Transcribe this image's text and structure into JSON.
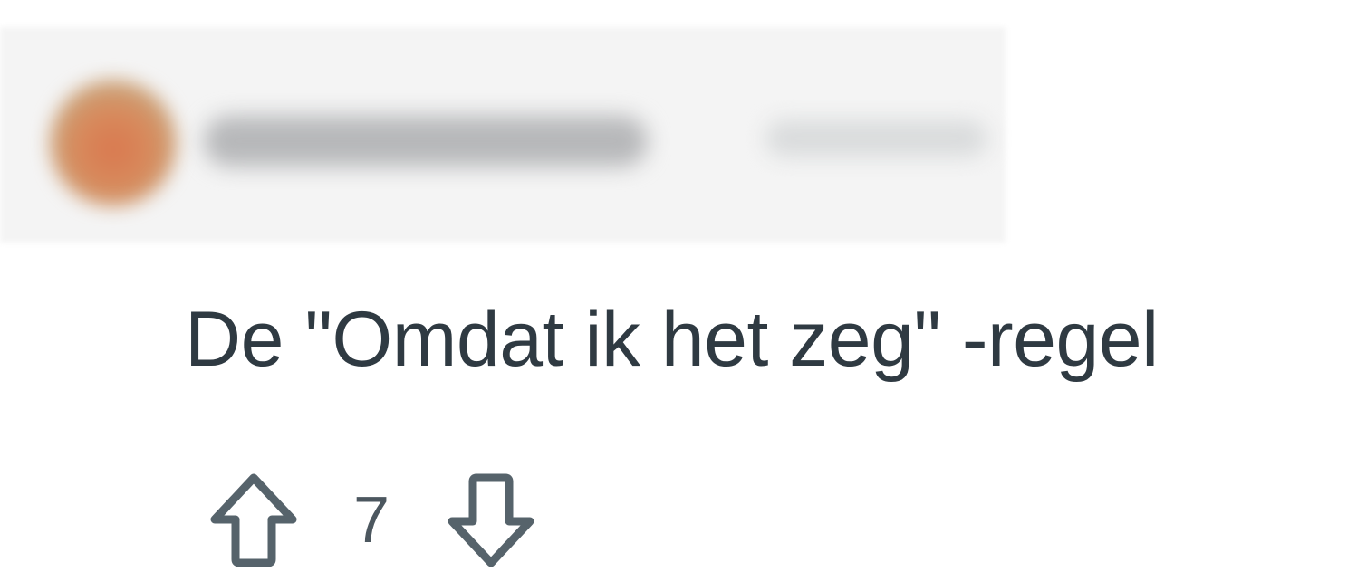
{
  "comment": {
    "text": "De \"Omdat ik het zeg\" -regel",
    "votes": {
      "upvote_icon": "arrow-up-outline-icon",
      "count": "7",
      "downvote_icon": "arrow-down-outline-icon"
    }
  },
  "colors": {
    "text": "#2f3a42",
    "icon": "#56636b",
    "background": "#ffffff"
  }
}
